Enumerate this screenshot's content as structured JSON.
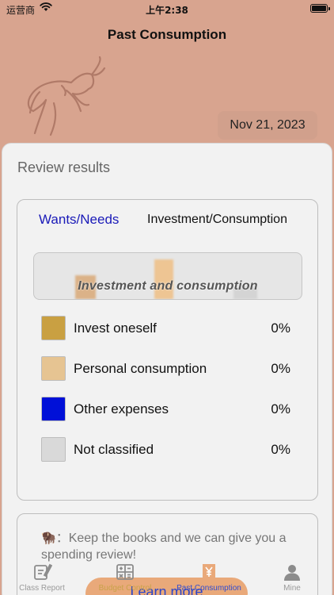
{
  "status_bar": {
    "carrier": "运营商",
    "time": "上午2:38"
  },
  "nav": {
    "title": "Past Consumption"
  },
  "date": "Nov 21, 2023",
  "panel": {
    "title": "Review results"
  },
  "tabs": {
    "wants_needs": "Wants/Needs",
    "investment_consumption": "Investment/Consumption"
  },
  "chart": {
    "caption": "Investment and consumption"
  },
  "chart_data": {
    "type": "bar",
    "title": "Investment and consumption",
    "categories": [
      "Invest oneself",
      "Personal consumption",
      "Other expenses",
      "Not classified"
    ],
    "values": [
      0,
      0,
      0,
      0
    ],
    "unit": "%"
  },
  "legend": [
    {
      "label": "Invest oneself",
      "percent": "0%",
      "color": "#c9a042"
    },
    {
      "label": "Personal consumption",
      "percent": "0%",
      "color": "#e6c492"
    },
    {
      "label": "Other expenses",
      "percent": "0%",
      "color": "#0010d8"
    },
    {
      "label": "Not classified",
      "percent": "0%",
      "color": "#d9d9d9"
    }
  ],
  "tip": {
    "icon": "🦬",
    "text": "：Keep the books and we can give you a spending review!"
  },
  "learn_more": "Learn more",
  "tabbar": [
    {
      "label": "Class Report",
      "icon": "edit-icon"
    },
    {
      "label": "Budget Control",
      "icon": "calculator-icon"
    },
    {
      "label": "Past Consumption",
      "icon": "yen-receipt-icon"
    },
    {
      "label": "Mine",
      "icon": "person-icon"
    }
  ]
}
